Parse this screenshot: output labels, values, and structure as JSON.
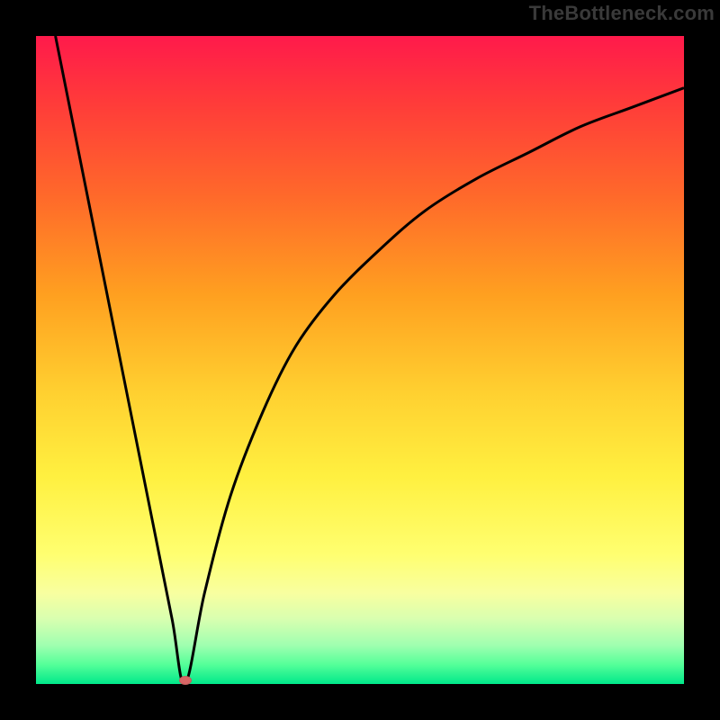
{
  "watermark": "TheBottleneck.com",
  "colors": {
    "curve_stroke": "#000000",
    "marker_fill": "#d86666",
    "frame_bg": "#000000"
  },
  "chart_data": {
    "type": "line",
    "title": "",
    "xlabel": "",
    "ylabel": "",
    "xlim": [
      0,
      1
    ],
    "ylim": [
      0,
      1
    ],
    "x_minimum": 0.23,
    "series": [
      {
        "name": "left-branch",
        "x": [
          0.03,
          0.06,
          0.09,
          0.12,
          0.15,
          0.18,
          0.21,
          0.23
        ],
        "values": [
          1.0,
          0.85,
          0.7,
          0.55,
          0.4,
          0.25,
          0.1,
          0.0
        ]
      },
      {
        "name": "right-branch",
        "x": [
          0.23,
          0.26,
          0.3,
          0.35,
          0.4,
          0.46,
          0.53,
          0.6,
          0.68,
          0.76,
          0.84,
          0.92,
          1.0
        ],
        "values": [
          0.0,
          0.14,
          0.29,
          0.42,
          0.52,
          0.6,
          0.67,
          0.73,
          0.78,
          0.82,
          0.86,
          0.89,
          0.92
        ]
      }
    ],
    "annotations": [
      {
        "type": "marker",
        "x": 0.23,
        "y": 0.0
      }
    ],
    "grid": false,
    "legend": false
  }
}
